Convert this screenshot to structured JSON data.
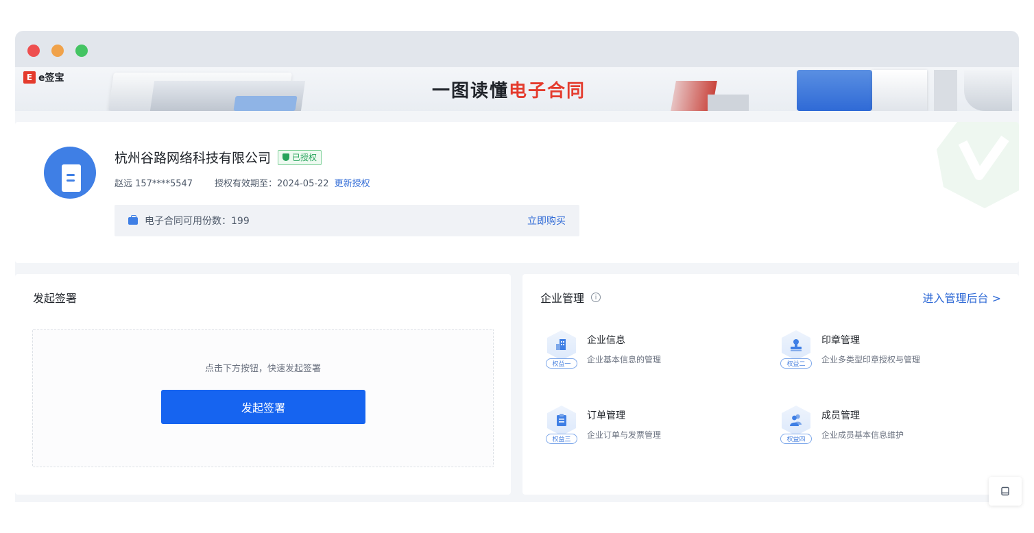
{
  "banner": {
    "logo_mark": "E",
    "logo_text": "e签宝",
    "title_dark": "一图读懂",
    "title_red": "电子合同"
  },
  "company": {
    "name": "杭州谷路网络科技有限公司",
    "badge": "已授权",
    "contact": "赵远 157****5547",
    "auth_expiry": "授权有效期至：2024-05-22",
    "renew_link": "更新授权",
    "quota_text": "电子合同可用份数：199",
    "buy_link": "立即购买"
  },
  "sign": {
    "title": "发起签署",
    "hint": "点击下方按钮，快速发起签署",
    "button": "发起签署"
  },
  "manage": {
    "title": "企业管理",
    "info_glyph": "i",
    "admin_link": "进入管理后台 >",
    "features": [
      {
        "title": "企业信息",
        "desc": "企业基本信息的管理",
        "tag": "权益一",
        "icon": "building-icon"
      },
      {
        "title": "印章管理",
        "desc": "企业多类型印章授权与管理",
        "tag": "权益二",
        "icon": "seal-icon"
      },
      {
        "title": "订单管理",
        "desc": "企业订单与发票管理",
        "tag": "权益三",
        "icon": "clipboard-icon"
      },
      {
        "title": "成员管理",
        "desc": "企业成员基本信息维护",
        "tag": "权益四",
        "icon": "members-icon"
      }
    ]
  },
  "colors": {
    "primary": "#1664f0",
    "link": "#2f6ad6",
    "success": "#25a35a",
    "brand_red": "#e43b2d"
  }
}
